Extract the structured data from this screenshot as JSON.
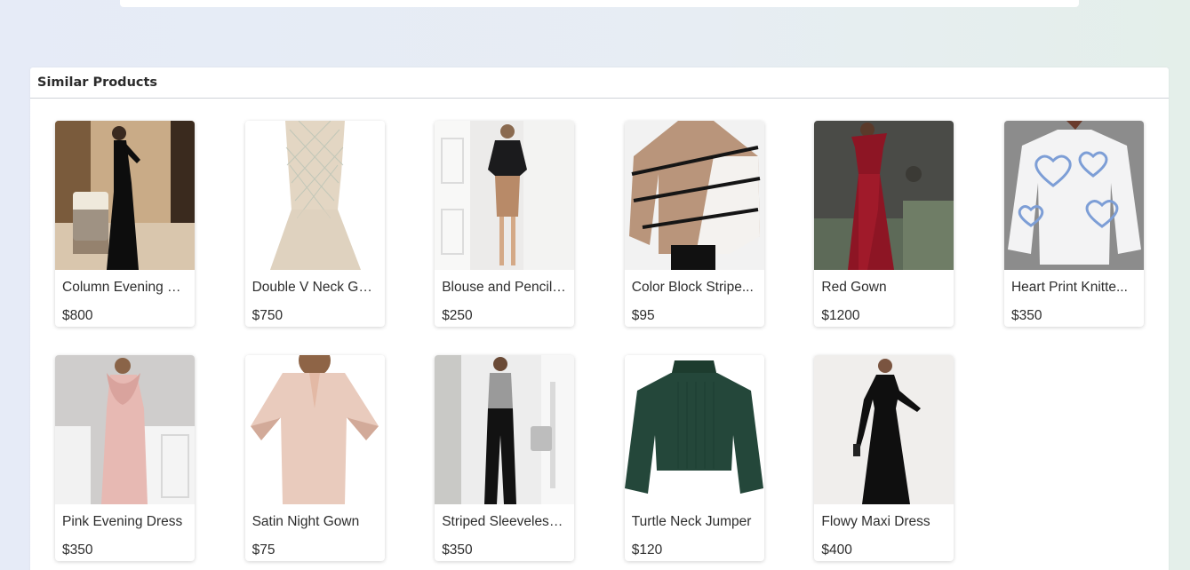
{
  "section": {
    "title": "Similar Products"
  },
  "products": [
    {
      "name": "Column Evening G...",
      "price": "$800",
      "icon": "black-gown-image"
    },
    {
      "name": "Double V Neck Go...",
      "price": "$750",
      "icon": "beaded-gown-image"
    },
    {
      "name": "Blouse and Pencil ...",
      "price": "$250",
      "icon": "blouse-skirt-image"
    },
    {
      "name": "Color Block Stripe...",
      "price": "$95",
      "icon": "striped-sweater-image"
    },
    {
      "name": "Red Gown",
      "price": "$1200",
      "icon": "red-gown-image"
    },
    {
      "name": "Heart Print Knitte...",
      "price": "$350",
      "icon": "heart-sweater-image"
    },
    {
      "name": "Pink Evening Dress",
      "price": "$350",
      "icon": "pink-dress-image"
    },
    {
      "name": "Satin Night Gown",
      "price": "$75",
      "icon": "satin-gown-image"
    },
    {
      "name": "Striped Sleeveless...",
      "price": "$350",
      "icon": "sleeveless-top-image"
    },
    {
      "name": "Turtle Neck Jumper",
      "price": "$120",
      "icon": "green-jumper-image"
    },
    {
      "name": "Flowy Maxi Dress",
      "price": "$400",
      "icon": "maxi-dress-image"
    }
  ]
}
